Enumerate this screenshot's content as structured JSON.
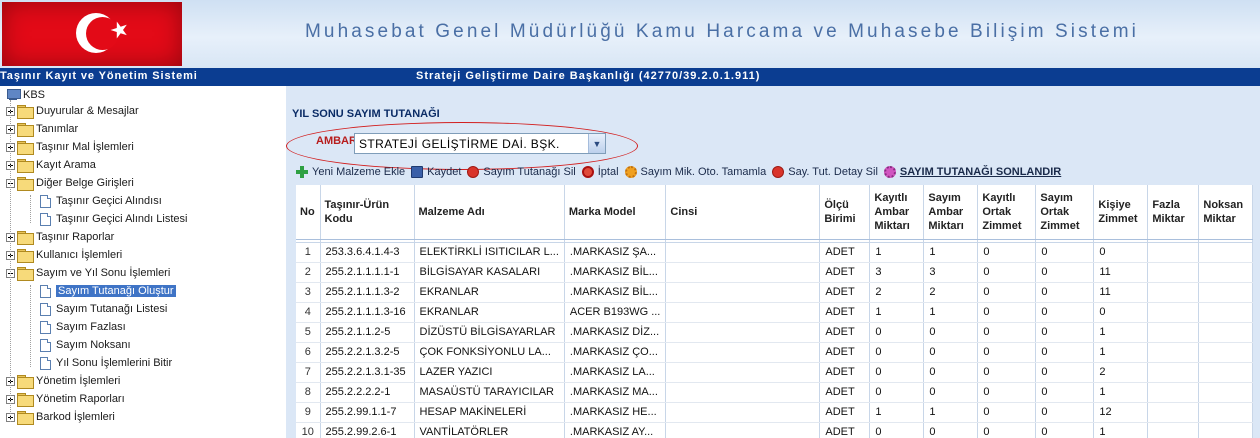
{
  "header": {
    "title": "Muhasebat Genel Müdürlüğü Kamu Harcama ve Muhasebe Bilişim Sistemi",
    "system_name": "Taşınır Kayıt ve Yönetim Sistemi",
    "unit": "Strateji Geliştirme Daire Başkanlığı (42770/39.2.0.1.911)"
  },
  "sidebar": {
    "root": "KBS",
    "items": [
      {
        "label": "Duyurular & Mesajlar",
        "type": "folder",
        "state": "collapsed"
      },
      {
        "label": "Tanımlar",
        "type": "folder",
        "state": "collapsed"
      },
      {
        "label": "Taşınır Mal İşlemleri",
        "type": "folder",
        "state": "collapsed"
      },
      {
        "label": "Kayıt Arama",
        "type": "folder",
        "state": "collapsed"
      },
      {
        "label": "Diğer Belge Girişleri",
        "type": "folder",
        "state": "expanded"
      },
      {
        "label": "Taşınır Geçici Alındısı",
        "type": "doc"
      },
      {
        "label": "Taşınır Geçici Alındı Listesi",
        "type": "doc"
      },
      {
        "label": "Taşınır Raporlar",
        "type": "folder",
        "state": "collapsed"
      },
      {
        "label": "Kullanıcı İşlemleri",
        "type": "folder",
        "state": "collapsed"
      },
      {
        "label": "Sayım ve Yıl Sonu İşlemleri",
        "type": "folder",
        "state": "expanded"
      },
      {
        "label": "Sayım Tutanağı Oluştur",
        "type": "doc",
        "selected": true
      },
      {
        "label": "Sayım Tutanağı Listesi",
        "type": "doc"
      },
      {
        "label": "Sayım Fazlası",
        "type": "doc"
      },
      {
        "label": "Sayım Noksanı",
        "type": "doc"
      },
      {
        "label": "Yıl Sonu İşlemlerini Bitir",
        "type": "doc"
      },
      {
        "label": "Yönetim İşlemleri",
        "type": "folder",
        "state": "collapsed"
      },
      {
        "label": "Yönetim Raporları",
        "type": "folder",
        "state": "collapsed"
      },
      {
        "label": "Barkod İşlemleri",
        "type": "folder",
        "state": "collapsed"
      }
    ]
  },
  "panel": {
    "title": "YIL SONU SAYIM TUTANAĞI",
    "ambar_label": "AMBAR:",
    "ambar_value": "STRATEJİ GELİŞTİRME DAİ. BŞK.",
    "highlight_color": "#d21f1f"
  },
  "toolbar": {
    "add": "Yeni Malzeme Ekle",
    "save": "Kaydet",
    "delete": "Sayım Tutanağı Sil",
    "cancel": "İptal",
    "auto_fill": "Sayım Mik. Oto. Tamamla",
    "detail_delete": "Say. Tut. Detay Sil",
    "finish": "SAYIM TUTANAĞI SONLANDIR"
  },
  "table": {
    "headers": {
      "no": "No",
      "code": "Taşınır-Ürün Kodu",
      "name": "Malzeme Adı",
      "brand": "Marka Model",
      "type": "Cinsi",
      "unit": "Ölçü Birimi",
      "reg_depot": "Kayıtlı Ambar Miktarı",
      "count_depot": "Sayım Ambar Miktarı",
      "reg_shared": "Kayıtlı Ortak Zimmet",
      "count_shared": "Sayım Ortak Zimmet",
      "personal": "Kişiye Zimmet",
      "surplus": "Fazla Miktar",
      "deficit": "Noksan Miktar"
    },
    "rows": [
      {
        "no": "1",
        "code": "253.3.6.4.1.4-3",
        "name": "ELEKTİRKLİ ISITICILAR L...",
        "brand": ".MARKASIZ ŞA...",
        "unit": "ADET",
        "reg_depot": "1",
        "count_depot": "1",
        "reg_shared": "0",
        "count_shared": "0",
        "personal": "0"
      },
      {
        "no": "2",
        "code": "255.2.1.1.1.1-1",
        "name": "BİLGİSAYAR KASALARI",
        "brand": ".MARKASIZ BİL...",
        "unit": "ADET",
        "reg_depot": "3",
        "count_depot": "3",
        "reg_shared": "0",
        "count_shared": "0",
        "personal": "11"
      },
      {
        "no": "3",
        "code": "255.2.1.1.1.3-2",
        "name": "EKRANLAR",
        "brand": ".MARKASIZ BİL...",
        "unit": "ADET",
        "reg_depot": "2",
        "count_depot": "2",
        "reg_shared": "0",
        "count_shared": "0",
        "personal": "11"
      },
      {
        "no": "4",
        "code": "255.2.1.1.1.3-16",
        "name": "EKRANLAR",
        "brand": "ACER B193WG ...",
        "unit": "ADET",
        "reg_depot": "1",
        "count_depot": "1",
        "reg_shared": "0",
        "count_shared": "0",
        "personal": "0"
      },
      {
        "no": "5",
        "code": "255.2.1.1.2-5",
        "name": "DİZÜSTÜ BİLGİSAYARLAR",
        "brand": ".MARKASIZ DİZ...",
        "unit": "ADET",
        "reg_depot": "0",
        "count_depot": "0",
        "reg_shared": "0",
        "count_shared": "0",
        "personal": "1"
      },
      {
        "no": "6",
        "code": "255.2.2.1.3.2-5",
        "name": "ÇOK FONKSİYONLU LA...",
        "brand": ".MARKASIZ ÇO...",
        "unit": "ADET",
        "reg_depot": "0",
        "count_depot": "0",
        "reg_shared": "0",
        "count_shared": "0",
        "personal": "1"
      },
      {
        "no": "7",
        "code": "255.2.2.1.3.1-35",
        "name": "LAZER YAZICI",
        "brand": ".MARKASIZ LA...",
        "unit": "ADET",
        "reg_depot": "0",
        "count_depot": "0",
        "reg_shared": "0",
        "count_shared": "0",
        "personal": "2"
      },
      {
        "no": "8",
        "code": "255.2.2.2.2-1",
        "name": "MASAÜSTÜ TARAYICILAR",
        "brand": ".MARKASIZ MA...",
        "unit": "ADET",
        "reg_depot": "0",
        "count_depot": "0",
        "reg_shared": "0",
        "count_shared": "0",
        "personal": "1"
      },
      {
        "no": "9",
        "code": "255.2.99.1.1-7",
        "name": "HESAP MAKİNELERİ",
        "brand": ".MARKASIZ HE...",
        "unit": "ADET",
        "reg_depot": "1",
        "count_depot": "1",
        "reg_shared": "0",
        "count_shared": "0",
        "personal": "12"
      },
      {
        "no": "10",
        "code": "255.2.99.2.6-1",
        "name": "VANTİLATÖRLER",
        "brand": ".MARKASIZ AY...",
        "unit": "ADET",
        "reg_depot": "0",
        "count_depot": "0",
        "reg_shared": "0",
        "count_shared": "0",
        "personal": "1"
      }
    ]
  }
}
